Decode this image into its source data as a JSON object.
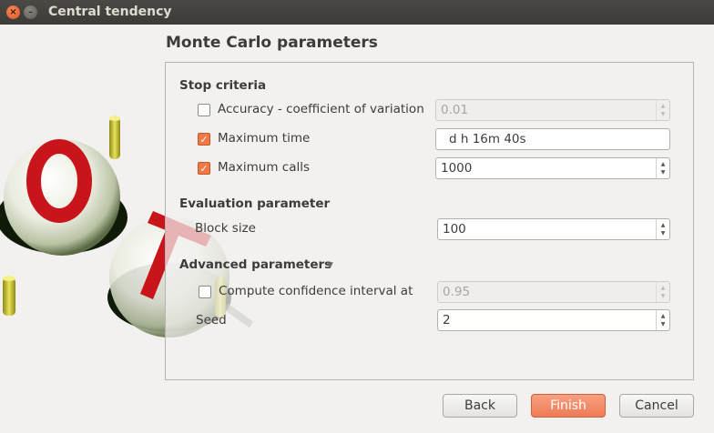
{
  "window": {
    "title": "Central tendency"
  },
  "page": {
    "heading": "Monte Carlo parameters"
  },
  "stop_criteria": {
    "title": "Stop criteria",
    "accuracy": {
      "label": "Accuracy - coefficient of variation",
      "checked": false,
      "value": "0.01",
      "enabled": false
    },
    "max_time": {
      "label": "Maximum time",
      "checked": true,
      "value": "d   h 16m 40s"
    },
    "max_calls": {
      "label": "Maximum calls",
      "checked": true,
      "value": "1000"
    }
  },
  "evaluation": {
    "title": "Evaluation parameter",
    "block_size": {
      "label": "Block size",
      "value": "100"
    }
  },
  "advanced": {
    "title": "Advanced parameters",
    "confidence": {
      "label": "Compute confidence interval at",
      "checked": false,
      "value": "0.95",
      "enabled": false
    },
    "seed": {
      "label": "Seed",
      "value": "2"
    }
  },
  "buttons": {
    "back": "Back",
    "finish": "Finish",
    "cancel": "Cancel"
  },
  "icons": {
    "close": "close-icon",
    "minimize": "minimize-icon",
    "expand": "triangle-down-icon",
    "spin_up": "spin-up-icon",
    "spin_down": "spin-down-icon",
    "check": "checkmark-icon"
  },
  "colors": {
    "accent": "#f07746",
    "titlebar": "#3c3b37",
    "background": "#f2f1f0"
  }
}
